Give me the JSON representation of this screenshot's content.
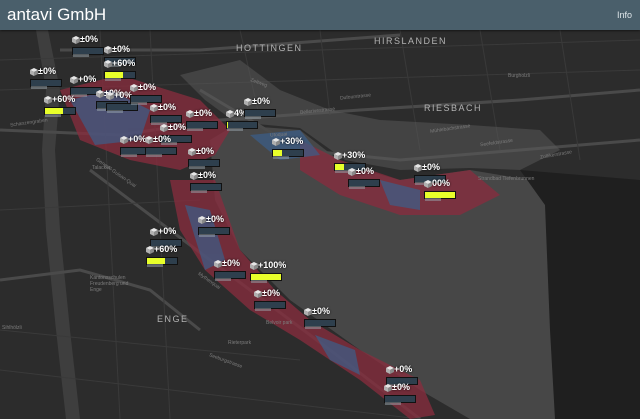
{
  "header": {
    "title": "antavi GmbH",
    "info_label": "Info"
  },
  "map": {
    "districts": [
      {
        "key": "hottingen",
        "label": "HOTTINGEN"
      },
      {
        "key": "hirslanden",
        "label": "HIRSLANDEN"
      },
      {
        "key": "riesbach",
        "label": "RIESBACH"
      },
      {
        "key": "enge",
        "label": "ENGE"
      }
    ],
    "streets": [
      "Zeltweg",
      "Zollikerstrasse",
      "Seefeldstrasse",
      "Mühlebachstrasse",
      "Dufourstrasse",
      "Bellerivestrasse",
      "Utoquai",
      "Mythenquai",
      "General-Guisan-Quai",
      "Talacker",
      "Burgholzli",
      "Rieterpark",
      "Belvoir park",
      "Kantonsschulen Freudenberg und Enge",
      "Strandbad Tiefenbrunnen",
      "Seeburgstrasse",
      "Sihlhölzli",
      "Schanzengraben"
    ],
    "markers": [
      {
        "id": "m1",
        "pct": "±0%",
        "fill": 0
      },
      {
        "id": "m2",
        "pct": "±0%",
        "fill": 0
      },
      {
        "id": "m3",
        "pct": "±0%",
        "fill": 0
      },
      {
        "id": "m4",
        "pct": "+60%",
        "fill": 0.6
      },
      {
        "id": "m5",
        "pct": "+0%",
        "fill": 0
      },
      {
        "id": "m6",
        "pct": "+60%",
        "fill": 0.6
      },
      {
        "id": "m7",
        "pct": "±0%",
        "fill": 0
      },
      {
        "id": "m8",
        "pct": "+0%",
        "fill": 0
      },
      {
        "id": "m9",
        "pct": "±0%",
        "fill": 0
      },
      {
        "id": "m10",
        "pct": "±0%",
        "fill": 0
      },
      {
        "id": "m11",
        "pct": "±0%",
        "fill": 0
      },
      {
        "id": "m12",
        "pct": "±0%",
        "fill": 0
      },
      {
        "id": "m13",
        "pct": "+0%",
        "fill": 0
      },
      {
        "id": "m14",
        "pct": "±0%",
        "fill": 0
      },
      {
        "id": "m15",
        "pct": "±0%",
        "fill": 0
      },
      {
        "id": "m16",
        "pct": "4%",
        "fill": 0.04
      },
      {
        "id": "m17",
        "pct": "+30%",
        "fill": 0.3
      },
      {
        "id": "m18",
        "pct": "+30%",
        "fill": 0.3
      },
      {
        "id": "m19",
        "pct": "±0%",
        "fill": 0
      },
      {
        "id": "m20",
        "pct": "±0%",
        "fill": 0
      },
      {
        "id": "m21",
        "pct": "00%",
        "fill": 1
      },
      {
        "id": "m22",
        "pct": "±0%",
        "fill": 0
      },
      {
        "id": "m23",
        "pct": "±0%",
        "fill": 0
      },
      {
        "id": "m24",
        "pct": "+0%",
        "fill": 0
      },
      {
        "id": "m25",
        "pct": "+60%",
        "fill": 0.6
      },
      {
        "id": "m26",
        "pct": "±0%",
        "fill": 0
      },
      {
        "id": "m27",
        "pct": "±0%",
        "fill": 0
      },
      {
        "id": "m28",
        "pct": "+100%",
        "fill": 1
      },
      {
        "id": "m29",
        "pct": "±0%",
        "fill": 0
      },
      {
        "id": "m30",
        "pct": "±0%",
        "fill": 0
      },
      {
        "id": "m31",
        "pct": "+0%",
        "fill": 0
      },
      {
        "id": "m32",
        "pct": "±0%",
        "fill": 0
      }
    ]
  },
  "colors": {
    "header": "#4a5f6b",
    "lake": "#444444",
    "land": "#2c2c2c",
    "zone_red": "#8a2c3e",
    "zone_blue": "#3b5f8a",
    "bar_fill": "#e8ff2a"
  }
}
